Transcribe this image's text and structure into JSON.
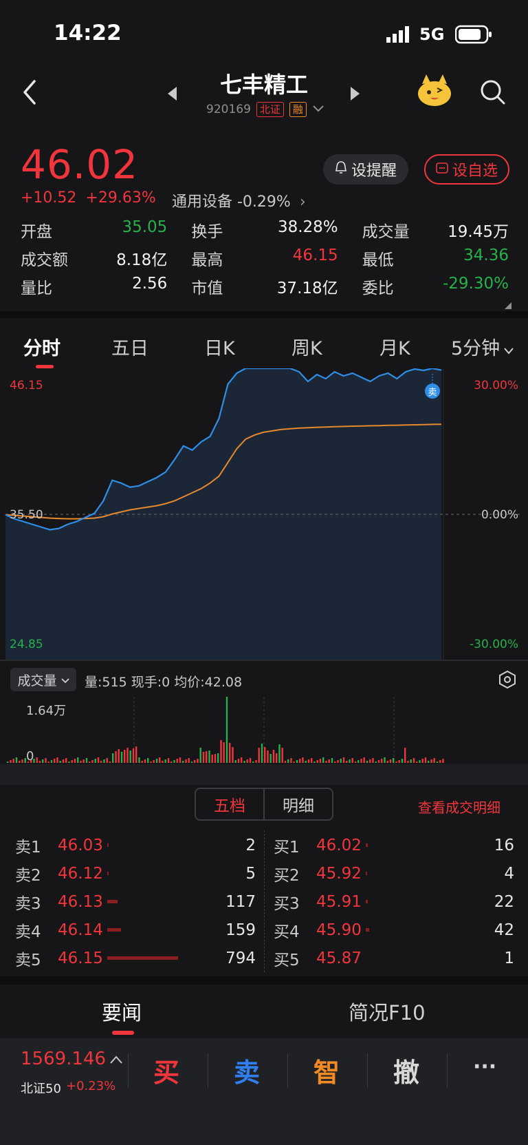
{
  "status": {
    "time": "14:22",
    "network": "5G"
  },
  "header": {
    "title": "七丰精工",
    "code": "920169",
    "tag_exchange": "北证",
    "tag_margin": "融"
  },
  "quote": {
    "price": "46.02",
    "change": "+10.52",
    "change_pct": "+29.63%",
    "sector": "通用设备 -0.29%",
    "remind_label": "设提醒",
    "watch_label": "设自选",
    "stats": [
      [
        {
          "label": "开盘",
          "value": "35.05",
          "color": "green"
        },
        {
          "label": "换手",
          "value": "38.28%",
          "color": "white"
        },
        {
          "label": "成交量",
          "value": "19.45万",
          "color": "white"
        }
      ],
      [
        {
          "label": "成交额",
          "value": "8.18亿",
          "color": "white"
        },
        {
          "label": "最高",
          "value": "46.15",
          "color": "red"
        },
        {
          "label": "最低",
          "value": "34.36",
          "color": "green"
        }
      ],
      [
        {
          "label": "量比",
          "value": "2.56",
          "color": "white"
        },
        {
          "label": "市值",
          "value": "37.18亿",
          "color": "white"
        },
        {
          "label": "委比",
          "value": "-29.30%",
          "color": "green"
        }
      ]
    ]
  },
  "tabs": [
    "分时",
    "五日",
    "日K",
    "周K",
    "月K",
    "5分钟"
  ],
  "chart": {
    "y_top_price": "46.15",
    "y_mid_price": "35.50",
    "y_bottom_price": "24.85",
    "y_top_pct": "30.00%",
    "y_mid_pct": "0.00%",
    "y_bottom_pct": "-30.00%",
    "sell_marker": "卖",
    "colors": {
      "price_line": "#2f8fe8",
      "avg_line": "#e8892e",
      "up": "#f0363c",
      "down": "#26b24a"
    }
  },
  "chart_data": {
    "type": "line",
    "ylim": [
      24.85,
      46.15
    ],
    "series": [
      {
        "values": [
          35.5,
          35.2,
          35.0,
          34.8,
          34.6,
          34.4,
          34.5,
          34.8,
          35.0,
          35.3,
          35.6,
          36.5,
          38.0,
          37.8,
          37.5,
          37.6,
          37.9,
          38.2,
          38.6,
          39.5,
          40.5,
          40.2,
          40.8,
          41.2,
          42.5,
          45.0,
          45.8,
          46.15,
          46.15,
          46.15,
          46.15,
          46.15,
          46.15,
          45.9,
          45.2,
          45.7,
          45.4,
          45.9,
          45.6,
          45.8,
          45.5,
          45.2,
          45.6,
          45.8,
          45.4,
          45.9,
          46.1,
          46.0,
          46.15,
          46.02
        ]
      },
      {
        "values": [
          35.5,
          35.45,
          35.4,
          35.35,
          35.3,
          35.25,
          35.22,
          35.2,
          35.2,
          35.22,
          35.25,
          35.35,
          35.55,
          35.7,
          35.85,
          35.95,
          36.05,
          36.15,
          36.3,
          36.5,
          36.8,
          37.1,
          37.4,
          37.8,
          38.3,
          39.3,
          40.3,
          41.0,
          41.3,
          41.5,
          41.6,
          41.7,
          41.75,
          41.8,
          41.83,
          41.86,
          41.88,
          41.9,
          41.92,
          41.94,
          41.95,
          41.97,
          41.98,
          42.0,
          42.01,
          42.03,
          42.04,
          42.05,
          42.07,
          42.08
        ]
      }
    ]
  },
  "volume": {
    "toggle_label": "成交量",
    "info": "量:515  现手:0  均价:42.08",
    "max_label": "1.64万",
    "zero_label": "0"
  },
  "orderbook": {
    "tab_active": "五档",
    "tab_other": "明细",
    "detail_link": "查看成交明细",
    "sell": [
      {
        "label": "卖1",
        "price": "46.03",
        "qty": "2"
      },
      {
        "label": "卖2",
        "price": "46.12",
        "qty": "5"
      },
      {
        "label": "卖3",
        "price": "46.13",
        "qty": "117"
      },
      {
        "label": "卖4",
        "price": "46.14",
        "qty": "159"
      },
      {
        "label": "卖5",
        "price": "46.15",
        "qty": "794"
      }
    ],
    "buy": [
      {
        "label": "买1",
        "price": "46.02",
        "qty": "16"
      },
      {
        "label": "买2",
        "price": "45.92",
        "qty": "4"
      },
      {
        "label": "买3",
        "price": "45.91",
        "qty": "22"
      },
      {
        "label": "买4",
        "price": "45.90",
        "qty": "42"
      },
      {
        "label": "买5",
        "price": "45.87",
        "qty": "1"
      }
    ]
  },
  "news_tabs": [
    "要闻",
    "简况F10"
  ],
  "bottom": {
    "index_value": "1569.146",
    "index_name": "北证50",
    "index_change": "+0.23%",
    "buy": "买",
    "sell": "卖",
    "smart": "智",
    "cancel": "撤",
    "more": "···"
  }
}
